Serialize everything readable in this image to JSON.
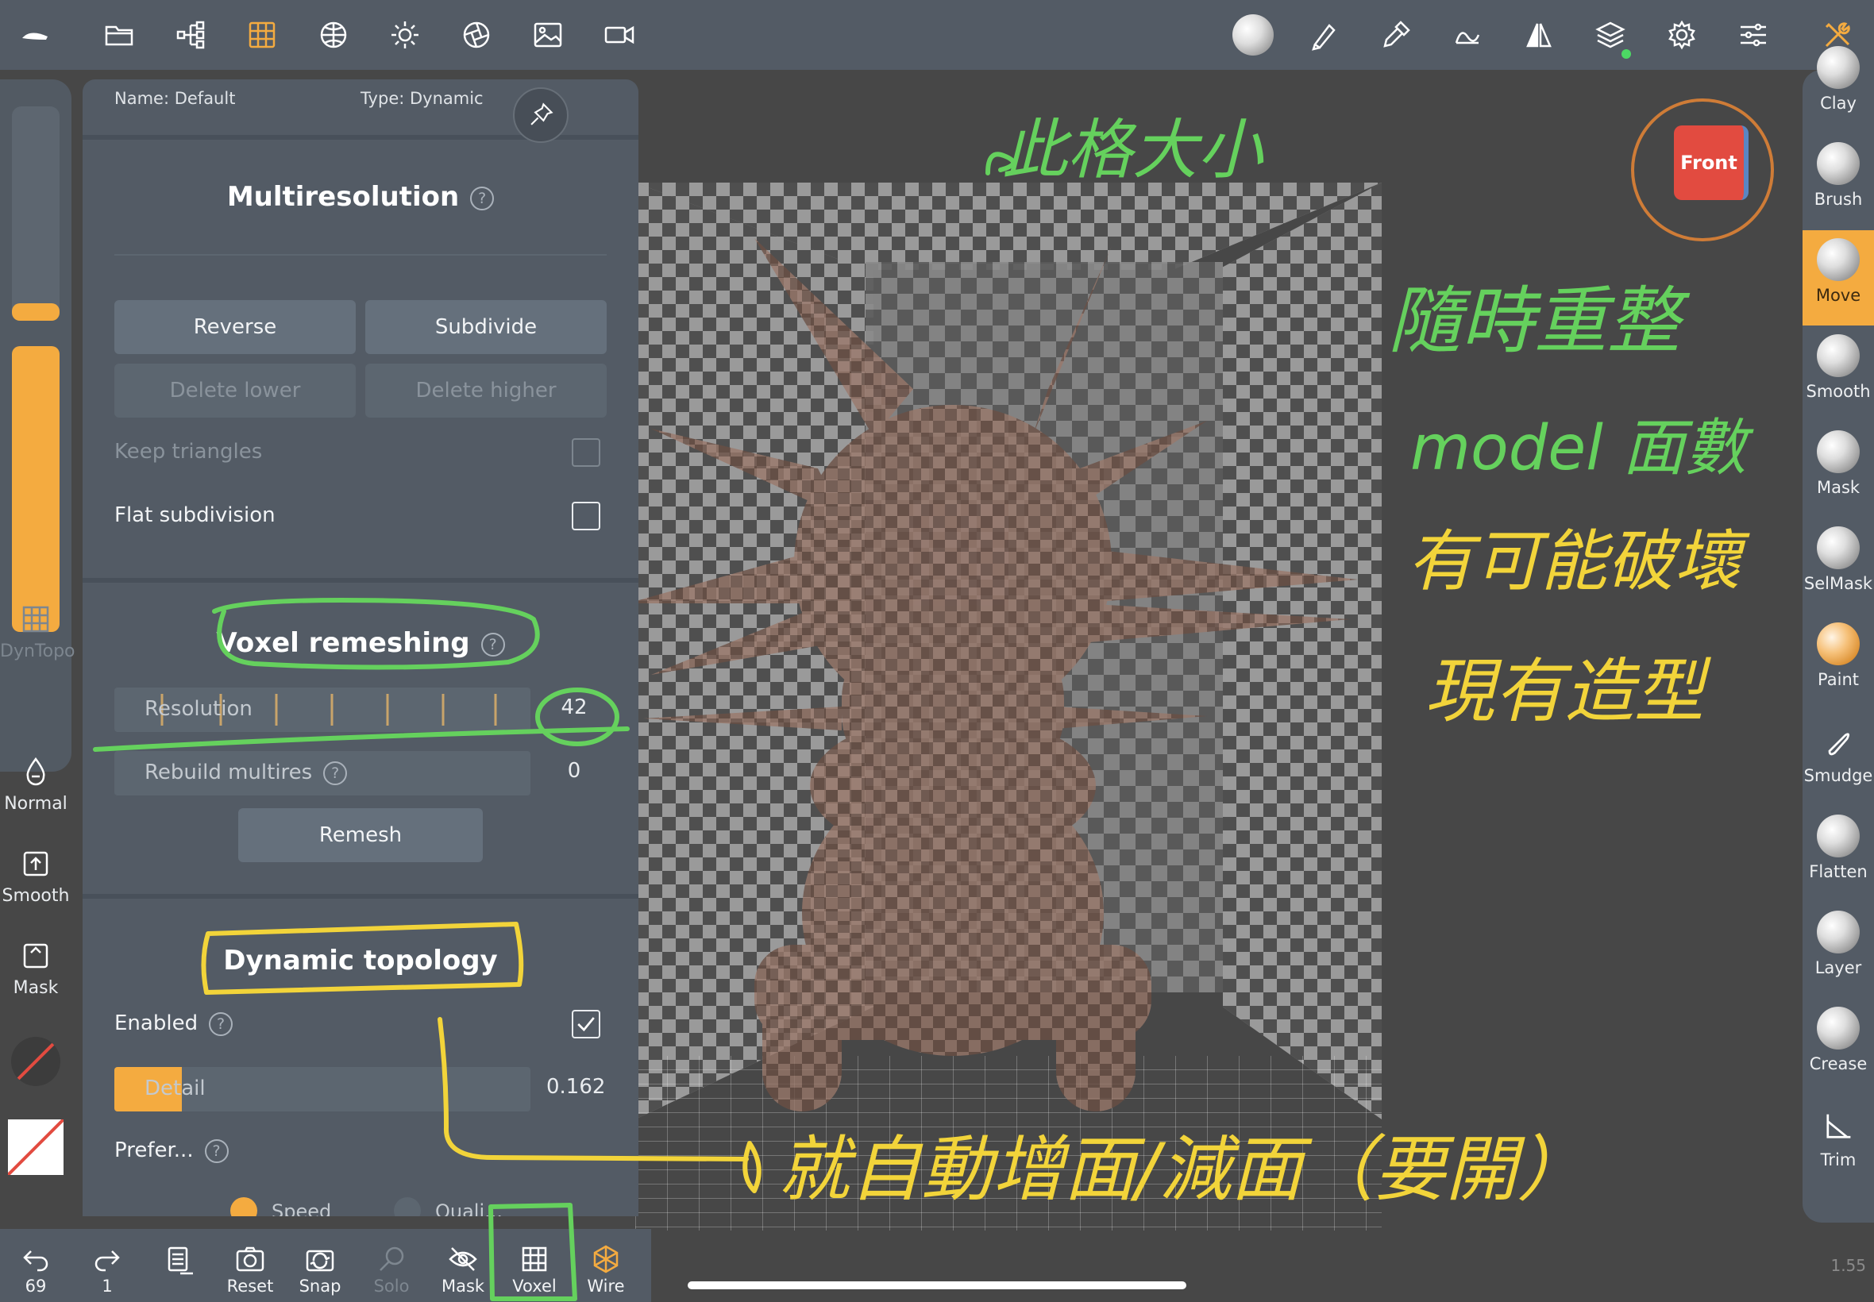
{
  "colors": {
    "accent": "#f4ab40",
    "panel": "#535b65",
    "annotation_green": "#65d15d",
    "annotation_yellow": "#f2d43a",
    "front_cube": "#e24b40"
  },
  "toolbar": {
    "left_icons": [
      "nomad-logo-icon",
      "folder-icon",
      "scene-tree-icon",
      "grid-icon",
      "material-sphere-icon",
      "light-sun-icon",
      "camera-shutter-icon",
      "image-icon",
      "video-camera-icon"
    ],
    "right_icons": [
      "matcap-sphere-icon",
      "brush-pen-icon",
      "pick-dropper-icon",
      "stroke-icon",
      "symmetry-icon",
      "layers-icon",
      "settings-gear-icon",
      "sliders-icon",
      "tools-icon"
    ]
  },
  "panel": {
    "name_label": "Name: Default",
    "type_label": "Type: Dynamic",
    "multires": {
      "title": "Multiresolution",
      "reverse": "Reverse",
      "subdivide": "Subdivide",
      "delete_lower": "Delete lower",
      "delete_higher": "Delete higher",
      "keep_triangles": "Keep triangles",
      "flat_subdivision": "Flat subdivision"
    },
    "voxel": {
      "title": "Voxel remeshing",
      "resolution_label": "Resolution",
      "resolution_value": "42",
      "rebuild_label": "Rebuild multires",
      "rebuild_value": "0",
      "remesh": "Remesh"
    },
    "dyntopo": {
      "title": "Dynamic topology",
      "enabled_label": "Enabled",
      "enabled": true,
      "detail_label": "Detail",
      "detail_value": "0.162",
      "detail_fraction": 0.162,
      "prefer_label": "Prefer...",
      "speed_label": "Speed",
      "quality_label": "Quali..."
    }
  },
  "left_tools": {
    "dyntopo_label": "DynTopo",
    "normal_label": "Normal",
    "smooth_label": "Smooth",
    "mask_label": "Mask"
  },
  "brushes": [
    {
      "label": "Clay",
      "active": false
    },
    {
      "label": "Brush",
      "active": false
    },
    {
      "label": "Move",
      "active": true
    },
    {
      "label": "Smooth",
      "active": false
    },
    {
      "label": "Mask",
      "active": false
    },
    {
      "label": "SelMask",
      "active": false
    },
    {
      "label": "Paint",
      "active": false
    },
    {
      "label": "Smudge",
      "active": false
    },
    {
      "label": "Flatten",
      "active": false
    },
    {
      "label": "Layer",
      "active": false
    },
    {
      "label": "Crease",
      "active": false
    },
    {
      "label": "Trim",
      "active": false
    }
  ],
  "gizmo": {
    "front_label": "Front"
  },
  "bottom": {
    "undo_count": "69",
    "redo_count": "1",
    "reset": "Reset",
    "snap": "Snap",
    "solo": "Solo",
    "mask": "Mask",
    "voxel": "Voxel",
    "wire": "Wire",
    "zoom": "1.55"
  },
  "annotations": {
    "top_note": "此格大小",
    "right_line1": "隨時重整",
    "right_line2": "model 面數",
    "right_line3": "有可能破壞",
    "right_line4": "現有造型",
    "bottom_note": "就自動增面/減面（要開）"
  }
}
